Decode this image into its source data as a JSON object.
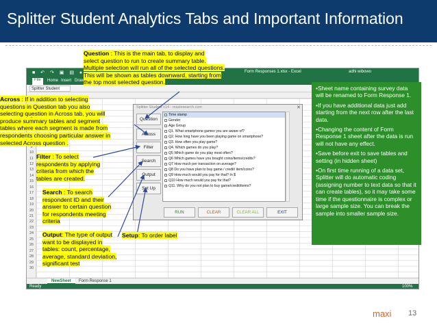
{
  "slide": {
    "title": "Splitter Student Analytics Tabs and Important Information",
    "brand": "maxi",
    "page_number": "13"
  },
  "excel": {
    "qat_icons": "■ ↶ ↷ ▣ ▤ ●",
    "window_title": "Form Responses 1.xlsx - Excel",
    "user_name": "adhi wibowo",
    "ribbon_tabs": [
      "File",
      "Home",
      "Insert",
      "Draw"
    ],
    "name_box": "Splitter Student",
    "row_numbers": [
      "1",
      "2",
      "3",
      "4",
      "5",
      "6",
      "7",
      "8",
      "9",
      "10",
      "11",
      "12",
      "13",
      "14",
      "15",
      "16",
      "17",
      "18",
      "19",
      "20",
      "21",
      "22",
      "23",
      "24",
      "25",
      "26",
      "27",
      "28",
      "29",
      "30"
    ],
    "sheet_tabs": [
      "NewSheet",
      "Form Response 1"
    ],
    "status": "Ready",
    "zoom": "100%"
  },
  "splitter": {
    "window_title": "Splitter Student v14 - maxiesearch.com",
    "close_glyph": "✕",
    "tabs": [
      "Question",
      "Across",
      "Filter",
      "Search",
      "Output",
      "Set Up"
    ],
    "questions": [
      "Time stamp",
      "Gender",
      "Age Group",
      "Q1. What smartphone games you are aware of?",
      "Q2. How long have you been playing game on smartphone?",
      "Q3. How often you play game?",
      "Q4. Which games do you play?",
      "Q5 Which game do you play most often?",
      "Q6 Which games have you bought coins/items/credits?",
      "Q7 How much per transaction on average?",
      "Q8 Do you have plan to buy game / credit/ item/coins?",
      "Q9 How much would you pay for that? In $",
      "Q10 How much would you pay for that?",
      "Q11. Why do you not plan to buy game/credit/items?"
    ],
    "actions": [
      "RUN",
      "CLEAR",
      "CLEAR ALL",
      "EXIT"
    ]
  },
  "annotations": {
    "question": {
      "label": "Question",
      "lines": [
        " : This is the main tab, to display and",
        "select question to run to create summary table.",
        "Multiple selection will run all of the selected questions.",
        "This will be shown as tables downward, starting from",
        "the top most selected question."
      ]
    },
    "across": {
      "label": "Across",
      "lines": [
        " : If in addition to selecting",
        "questions in Question tab you also",
        "selecting question in Across tab, you will",
        "produce summary tables and segment",
        "tables where each segment is made from",
        "respondents choosing particular answer in",
        "selected Across question ."
      ]
    },
    "filter": {
      "label": "Filter",
      "lines": [
        " : To select",
        "respondents by applying",
        "criteria from which the",
        "tables are created."
      ]
    },
    "search": {
      "label": "Search",
      "lines": [
        " : To search",
        "respondent ID and their",
        "answer to certain question",
        "for respondents meeting",
        "criteria"
      ]
    },
    "output": {
      "label": "Output",
      "lines": [
        ": The type of output",
        "want to be displayed in",
        "tables: count, percentage,",
        "average, standard deviation,",
        "significant test"
      ]
    },
    "setup": {
      "label": "Setup",
      "text": ": To order label"
    }
  },
  "info_box": {
    "bullets": [
      "Sheet name containing survey data will be renamed to Form Response 1.",
      "If you have additional data just add starting from the next row after the last data.",
      "Changing the content of Form Response 1 sheet after the data is run will not have any effect.",
      "Save before exit to save tables and setting (in hidden sheet)",
      "On first time running of a data set, Splitter will do automatic coding (assigning number to text data so that it can create tables), so it may take some time if the questionnaire is complex or large sample size. You can break the sample into smaller sample size."
    ]
  },
  "colors": {
    "header_bg": "#0d3b6e",
    "excel_green": "#217346",
    "annotation_highlight": "#ffff00",
    "info_box_bg": "#2d8f2a",
    "arrow_blue": "#2c4aa0",
    "brand_orange": "#d9652a"
  }
}
